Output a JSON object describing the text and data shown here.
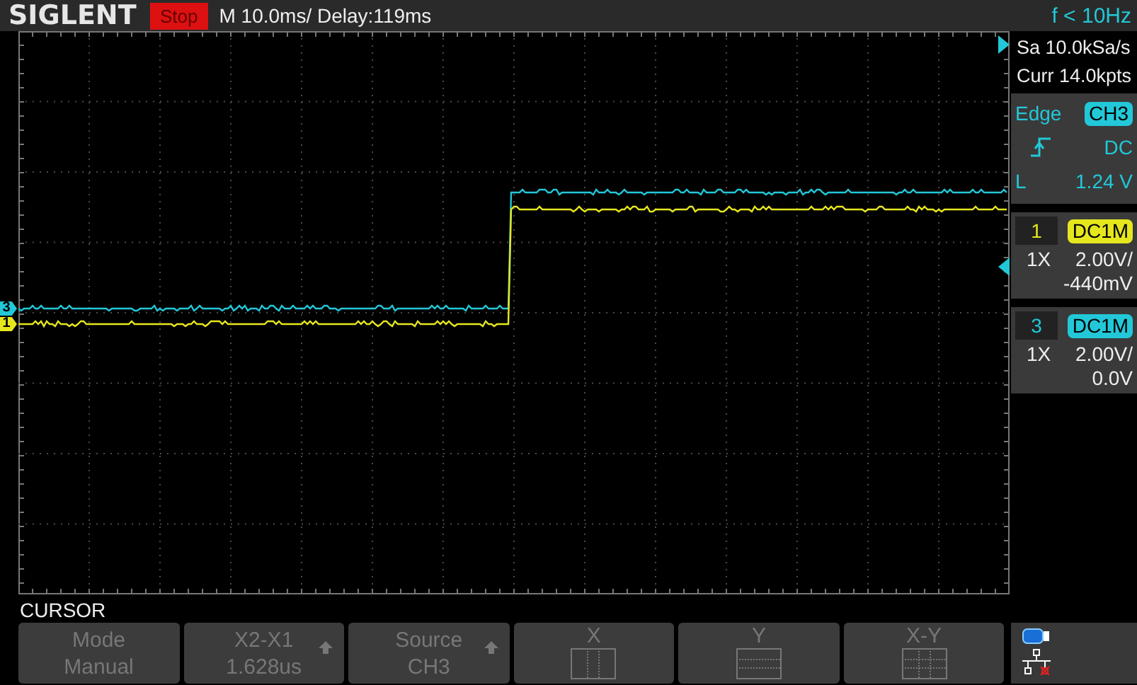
{
  "header": {
    "logo": "SIGLENT",
    "run_state": "Stop",
    "timebase": "M 10.0ms/ Delay:119ms",
    "frequency": "f < 10Hz"
  },
  "acquisition": {
    "sample_rate": "Sa 10.0kSa/s",
    "memory": "Curr 14.0kpts"
  },
  "trigger": {
    "type": "Edge",
    "source": "CH3",
    "coupling": "DC",
    "level_label": "L",
    "level": "1.24 V"
  },
  "channels": [
    {
      "number": "1",
      "coupling": "DC1M",
      "probe": "1X",
      "scale": "2.00V/",
      "offset": "-440mV",
      "color": "#e6e61e"
    },
    {
      "number": "3",
      "coupling": "DC1M",
      "probe": "1X",
      "scale": "2.00V/",
      "offset": "0.0V",
      "color": "#22c8d8"
    }
  ],
  "traces": [
    {
      "marker": "3",
      "color": "#22c8d8"
    },
    {
      "marker": "1",
      "color": "#e6e61e"
    }
  ],
  "menu": {
    "title": "CURSOR",
    "softkeys": [
      {
        "kind": "text",
        "label": "Mode",
        "value": "Manual",
        "arrow": false
      },
      {
        "kind": "text",
        "label": "X2-X1",
        "value": "1.628us",
        "arrow": true
      },
      {
        "kind": "text",
        "label": "Source",
        "value": "CH3",
        "arrow": true
      },
      {
        "kind": "x",
        "label": "X"
      },
      {
        "kind": "y",
        "label": "Y"
      },
      {
        "kind": "xy",
        "label": "X-Y"
      }
    ]
  }
}
